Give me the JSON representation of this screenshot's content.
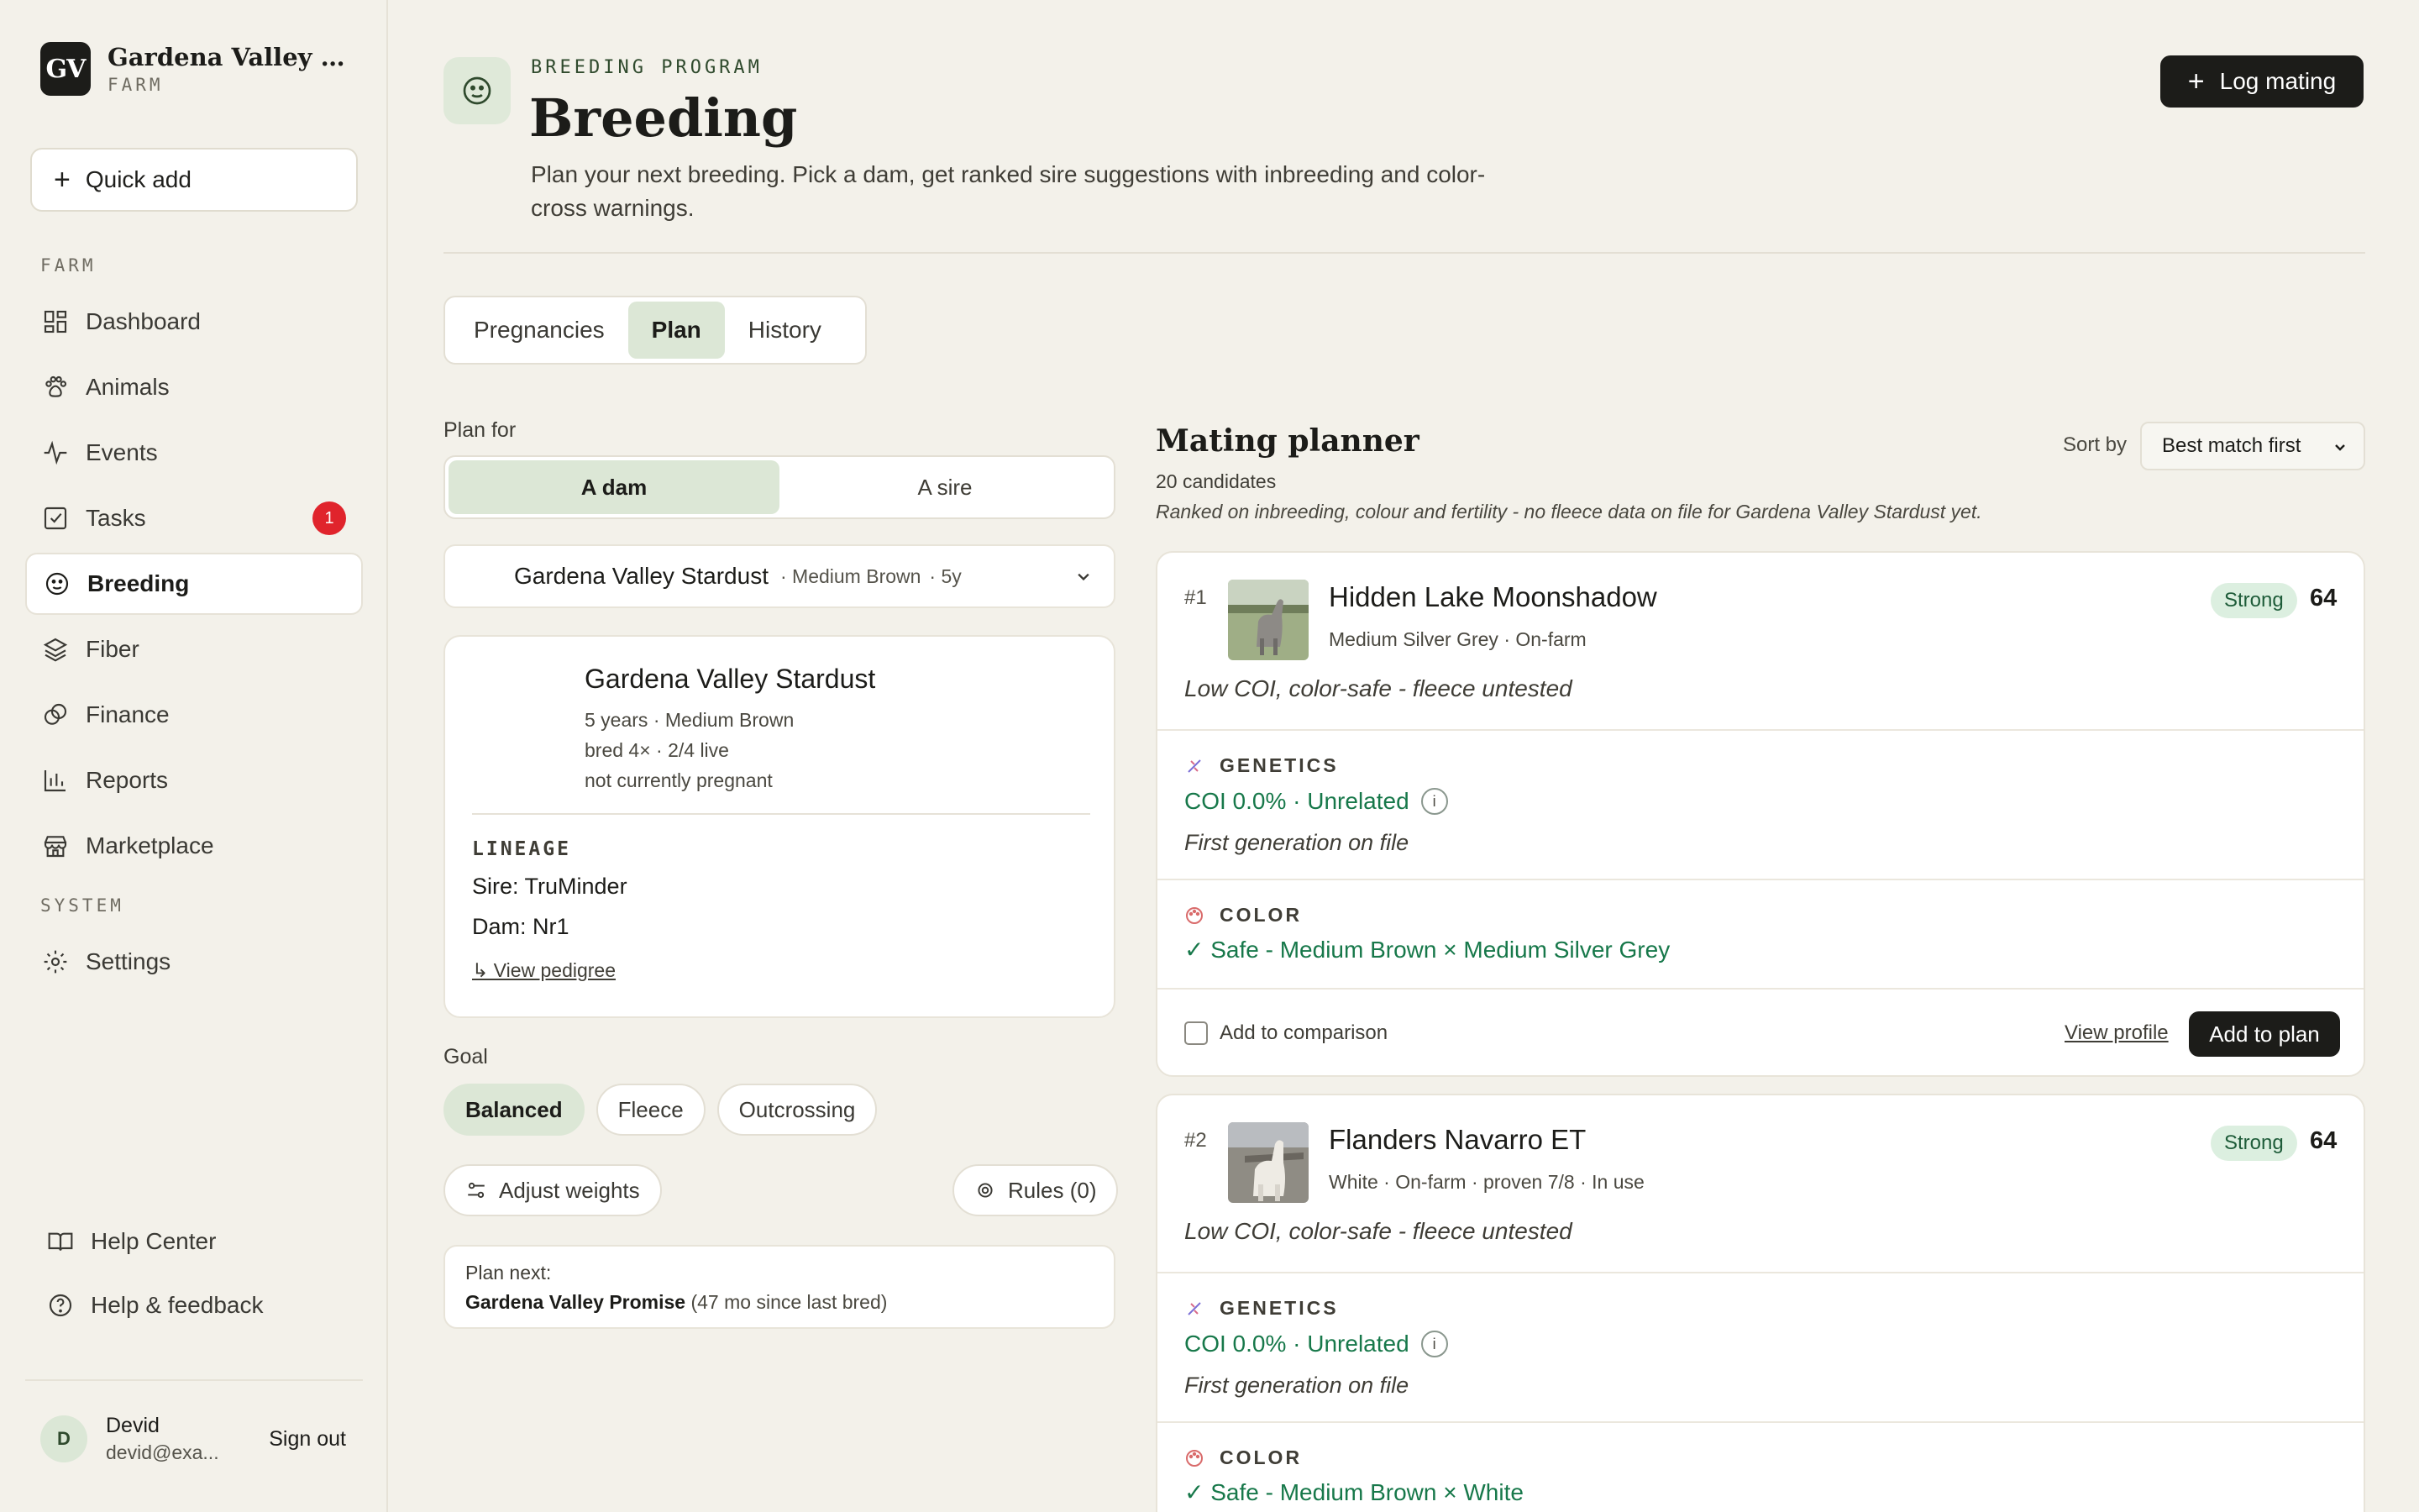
{
  "brand": {
    "logo": "GV",
    "name": "Gardena Valley Alp...",
    "sub": "FARM"
  },
  "sidebar": {
    "quick_add": "Quick add",
    "section_farm": "FARM",
    "section_system": "SYSTEM",
    "items": [
      {
        "label": "Dashboard",
        "icon": "grid-icon"
      },
      {
        "label": "Animals",
        "icon": "paw-icon"
      },
      {
        "label": "Events",
        "icon": "activity-icon"
      },
      {
        "label": "Tasks",
        "icon": "checkbox-icon",
        "badge": "1"
      },
      {
        "label": "Breeding",
        "icon": "breeding-icon",
        "active": true
      },
      {
        "label": "Fiber",
        "icon": "layers-icon"
      },
      {
        "label": "Finance",
        "icon": "coins-icon"
      },
      {
        "label": "Reports",
        "icon": "bar-chart-icon"
      },
      {
        "label": "Marketplace",
        "icon": "store-icon"
      }
    ],
    "settings": "Settings",
    "help_center": "Help Center",
    "help_feedback": "Help & feedback",
    "user": {
      "initial": "D",
      "name": "Devid",
      "email": "devid@exa...",
      "sign_out": "Sign out"
    }
  },
  "header": {
    "eyebrow": "BREEDING PROGRAM",
    "title": "Breeding",
    "description": "Plan your next breeding. Pick a dam, get ranked sire suggestions with inbreeding and color-cross warnings.",
    "log_button": "Log mating"
  },
  "tabs": [
    "Pregnancies",
    "Plan",
    "History"
  ],
  "active_tab": "Plan",
  "plan_for": {
    "label": "Plan for",
    "options": [
      "A dam",
      "A sire"
    ],
    "selected": "A dam"
  },
  "animal_select": {
    "name": "Gardena Valley Stardust",
    "color": "· Medium Brown",
    "age": "· 5y"
  },
  "dam_card": {
    "name": "Gardena Valley Stardust",
    "line1": "5 years · Medium Brown",
    "line2": "bred 4× · 2/4 live",
    "line3": "not currently pregnant",
    "lineage_heading": "LINEAGE",
    "sire": "Sire: TruMinder",
    "dam": "Dam: Nr1",
    "view_pedigree": "↳ View pedigree"
  },
  "goal": {
    "label": "Goal",
    "options": [
      "Balanced",
      "Fleece",
      "Outcrossing"
    ],
    "selected": "Balanced"
  },
  "adjust_weights": "Adjust weights",
  "rules": "Rules (0)",
  "plan_next": {
    "label": "Plan next:",
    "name": "Gardena Valley Promise",
    "detail": "(47 mo since last bred)"
  },
  "planner": {
    "title": "Mating planner",
    "count": "20 candidates",
    "note": "Ranked on inbreeding, colour and fertility - no fleece data on file for Gardena Valley Stardust yet.",
    "sort_label": "Sort by",
    "sort_value": "Best match first",
    "candidates": [
      {
        "rank": "#1",
        "name": "Hidden Lake Moonshadow",
        "meta": "Medium Silver Grey · On-farm",
        "strength": "Strong",
        "score": "64",
        "summary": "Low COI, color-safe - fleece untested",
        "genetics_heading": "GENETICS",
        "coi": "COI 0.0% · Unrelated",
        "generation": "First generation on file",
        "color_heading": "COLOR",
        "color": "✓ Safe - Medium Brown × Medium Silver Grey",
        "compare": "Add to comparison",
        "view_profile": "View profile",
        "add_plan": "Add to plan"
      },
      {
        "rank": "#2",
        "name": "Flanders Navarro ET",
        "meta": "White · On-farm · proven 7/8 · In use",
        "strength": "Strong",
        "score": "64",
        "summary": "Low COI, color-safe - fleece untested",
        "genetics_heading": "GENETICS",
        "coi": "COI 0.0% · Unrelated",
        "generation": "First generation on file",
        "color_heading": "COLOR",
        "color": "✓ Safe - Medium Brown × White"
      }
    ]
  },
  "colors": {
    "accent_green": "#dce7d6",
    "positive_text": "#17784a",
    "badge_red": "#e0242c",
    "dark_button": "#1c1c19"
  }
}
